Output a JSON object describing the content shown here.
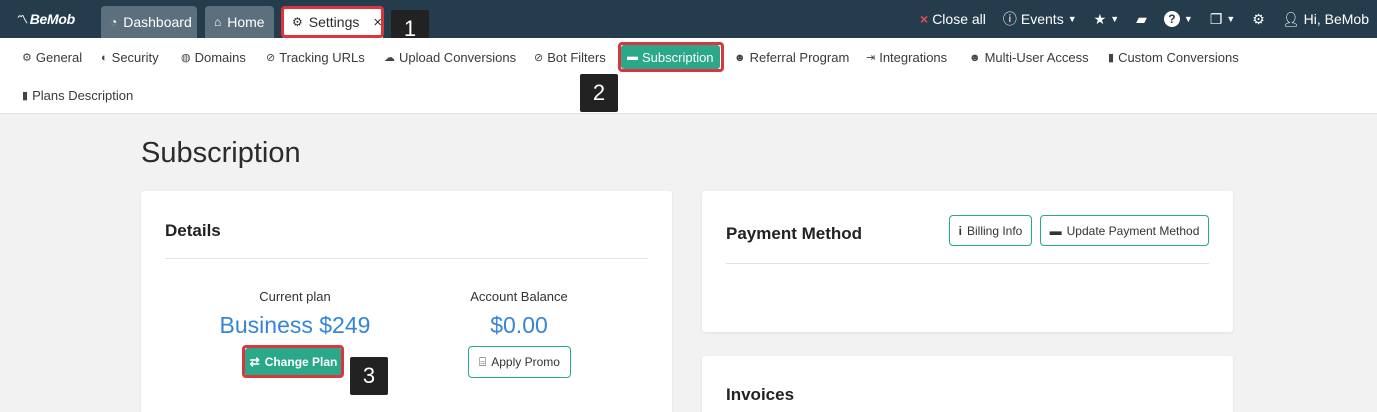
{
  "app": {
    "logo": "BeMob"
  },
  "tabs": [
    {
      "label": "Dashboard",
      "icon": "dashboard-icon"
    },
    {
      "label": "Home",
      "icon": "home-icon"
    },
    {
      "label": "Settings",
      "icon": "gear-icon",
      "close": "×"
    }
  ],
  "topbar": {
    "close_all": "Close all",
    "events": "Events",
    "user": "Hi, BeMob"
  },
  "subnav": [
    {
      "label": "General",
      "icon": "gear-icon"
    },
    {
      "label": "Security",
      "icon": "shield-icon"
    },
    {
      "label": "Domains",
      "icon": "globe-icon"
    },
    {
      "label": "Tracking URLs",
      "icon": "link-icon"
    },
    {
      "label": "Upload Conversions",
      "icon": "cloud-upload-icon"
    },
    {
      "label": "Bot Filters",
      "icon": "ban-icon"
    },
    {
      "label": "Subscription",
      "icon": "credit-card-icon"
    },
    {
      "label": "Referral Program",
      "icon": "users-icon"
    },
    {
      "label": "Integrations",
      "icon": "plug-icon"
    },
    {
      "label": "Multi-User Access",
      "icon": "users-icon"
    },
    {
      "label": "Custom Conversions",
      "icon": "file-icon"
    },
    {
      "label": "Plans Description",
      "icon": "file-icon"
    }
  ],
  "annotations": [
    "1",
    "2",
    "3"
  ],
  "page": {
    "title": "Subscription"
  },
  "details": {
    "title": "Details",
    "current_plan_label": "Current plan",
    "current_plan_value": "Business $249",
    "balance_label": "Account Balance",
    "balance_value": "$0.00",
    "change_plan": "Change Plan",
    "apply_promo": "Apply Promo"
  },
  "payment": {
    "title": "Payment Method",
    "billing_info": "Billing Info",
    "update_method": "Update Payment Method"
  },
  "invoices": {
    "title": "Invoices"
  },
  "colors": {
    "topbar": "#253c4c",
    "accent": "#2ba78a",
    "highlight": "#d9363e",
    "link_blue": "#3585d6"
  }
}
